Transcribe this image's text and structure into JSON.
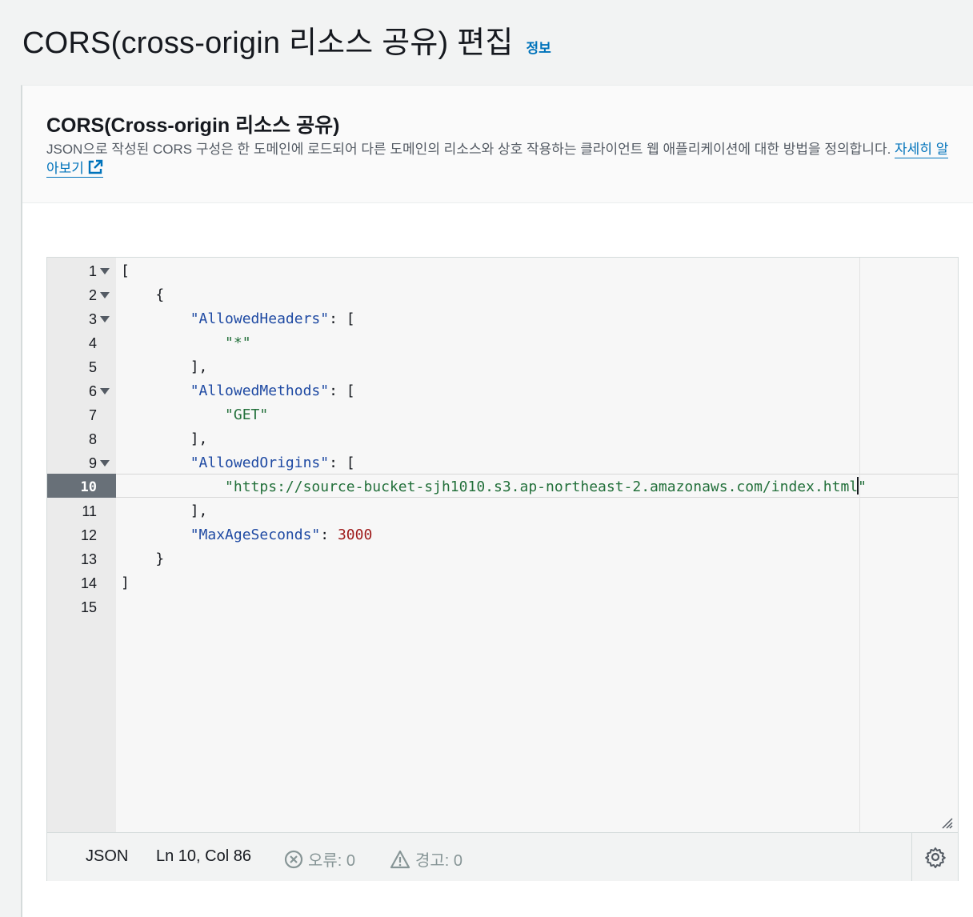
{
  "header": {
    "title": "CORS(cross-origin 리소스 공유) 편집",
    "info_link": "정보"
  },
  "section": {
    "title": "CORS(Cross-origin 리소스 공유)",
    "description": "JSON으로 작성된 CORS 구성은 한 도메인에 로드되어 다른 도메인의 리소스와 상호 작용하는 클라이언트 웹 애플리케이션에 대한 방법을 정의합니다.",
    "learn_more": "자세히 알아보기"
  },
  "editor": {
    "lines": [
      {
        "num": "1",
        "indent": "",
        "parts": [
          {
            "t": "[",
            "c": ""
          }
        ],
        "fold": true
      },
      {
        "num": "2",
        "indent": "    ",
        "parts": [
          {
            "t": "{",
            "c": ""
          }
        ],
        "fold": true
      },
      {
        "num": "3",
        "indent": "        ",
        "parts": [
          {
            "t": "\"AllowedHeaders\"",
            "c": "s-key"
          },
          {
            "t": ": [",
            "c": ""
          }
        ],
        "fold": true
      },
      {
        "num": "4",
        "indent": "            ",
        "parts": [
          {
            "t": "\"*\"",
            "c": "s-str"
          }
        ],
        "fold": false
      },
      {
        "num": "5",
        "indent": "        ",
        "parts": [
          {
            "t": "],",
            "c": ""
          }
        ],
        "fold": false
      },
      {
        "num": "6",
        "indent": "        ",
        "parts": [
          {
            "t": "\"AllowedMethods\"",
            "c": "s-key"
          },
          {
            "t": ": [",
            "c": ""
          }
        ],
        "fold": true
      },
      {
        "num": "7",
        "indent": "            ",
        "parts": [
          {
            "t": "\"GET\"",
            "c": "s-str"
          }
        ],
        "fold": false
      },
      {
        "num": "8",
        "indent": "        ",
        "parts": [
          {
            "t": "],",
            "c": ""
          }
        ],
        "fold": false
      },
      {
        "num": "9",
        "indent": "        ",
        "parts": [
          {
            "t": "\"AllowedOrigins\"",
            "c": "s-key"
          },
          {
            "t": ": [",
            "c": ""
          }
        ],
        "fold": true
      },
      {
        "num": "10",
        "indent": "            ",
        "parts": [
          {
            "t": "\"https://source-bucket-sjh1010.s3.ap-northeast-2.amazonaws.com/index.html",
            "c": "s-str"
          },
          {
            "t": "|",
            "c": "cursor"
          },
          {
            "t": "\"",
            "c": "s-str"
          }
        ],
        "fold": false,
        "active": true
      },
      {
        "num": "11",
        "indent": "        ",
        "parts": [
          {
            "t": "],",
            "c": ""
          }
        ],
        "fold": false
      },
      {
        "num": "12",
        "indent": "        ",
        "parts": [
          {
            "t": "\"MaxAgeSeconds\"",
            "c": "s-key"
          },
          {
            "t": ": ",
            "c": ""
          },
          {
            "t": "3000",
            "c": "s-num"
          }
        ],
        "fold": false
      },
      {
        "num": "13",
        "indent": "    ",
        "parts": [
          {
            "t": "}",
            "c": ""
          }
        ],
        "fold": false
      },
      {
        "num": "14",
        "indent": "",
        "parts": [
          {
            "t": "]",
            "c": ""
          }
        ],
        "fold": false
      },
      {
        "num": "15",
        "indent": "",
        "parts": [],
        "fold": false
      }
    ]
  },
  "status": {
    "language": "JSON",
    "position": "Ln 10, Col 86",
    "errors": "오류: 0",
    "warnings": "경고: 0"
  },
  "colors": {
    "link": "#0073bb",
    "key": "#1f4aa3",
    "string": "#23703b",
    "number": "#9e1a1a",
    "active_gutter": "#687078"
  },
  "icons": [
    "external-link-icon",
    "fold-arrow-icon",
    "error-icon",
    "warning-icon",
    "settings-gear-icon",
    "resize-handle-icon"
  ]
}
